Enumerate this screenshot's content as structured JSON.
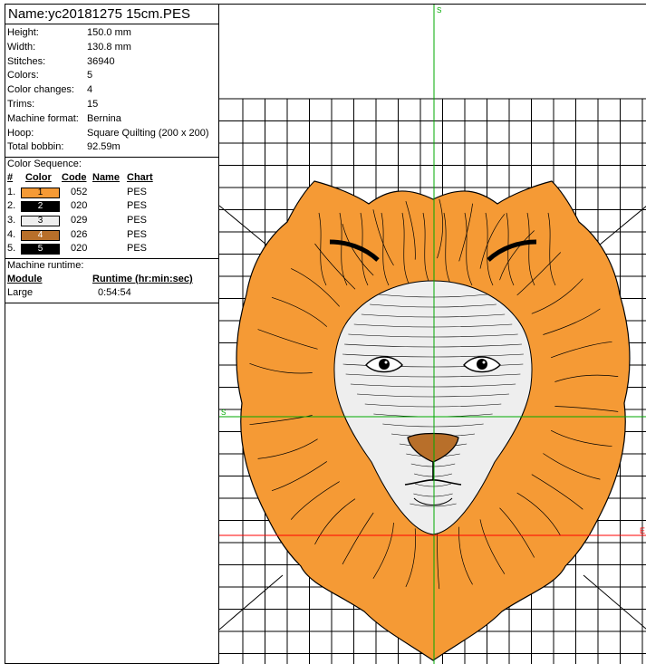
{
  "design": {
    "title": "Name:yc20181275 15cm.PES"
  },
  "properties": [
    {
      "label": "Height:",
      "value": "150.0 mm"
    },
    {
      "label": "Width:",
      "value": "130.8 mm"
    },
    {
      "label": "Stitches:",
      "value": "36940"
    },
    {
      "label": "Colors:",
      "value": "5"
    },
    {
      "label": "Color changes:",
      "value": "4"
    },
    {
      "label": "Trims:",
      "value": "15"
    },
    {
      "label": "Machine format:",
      "value": "Bernina"
    },
    {
      "label": "Hoop:",
      "value": "Square Quilting (200 x 200)"
    },
    {
      "label": "Total bobbin:",
      "value": "92.59m"
    }
  ],
  "color_sequence": {
    "title": "Color Sequence:",
    "headers": {
      "num": "#",
      "color": "Color",
      "code": "Code",
      "name": "Name",
      "chart": "Chart"
    },
    "rows": [
      {
        "num": "1.",
        "swatch_label": "1",
        "swatch_color": "#f59a35",
        "text_color": "#000000",
        "code": "052",
        "name": "",
        "chart": "PES"
      },
      {
        "num": "2.",
        "swatch_label": "2",
        "swatch_color": "#000000",
        "text_color": "#ffffff",
        "code": "020",
        "name": "",
        "chart": "PES"
      },
      {
        "num": "3.",
        "swatch_label": "3",
        "swatch_color": "#eeeeee",
        "text_color": "#000000",
        "code": "029",
        "name": "",
        "chart": "PES"
      },
      {
        "num": "4.",
        "swatch_label": "4",
        "swatch_color": "#b86f2a",
        "text_color": "#ffffff",
        "code": "026",
        "name": "",
        "chart": "PES"
      },
      {
        "num": "5.",
        "swatch_label": "5",
        "swatch_color": "#000000",
        "text_color": "#ffffff",
        "code": "020",
        "name": "",
        "chart": "PES"
      }
    ]
  },
  "runtime": {
    "title": "Machine runtime:",
    "headers": {
      "module": "Module",
      "runtime": "Runtime (hr:min:sec)"
    },
    "rows": [
      {
        "module": "Large",
        "runtime": "0:54:54"
      }
    ]
  },
  "canvas": {
    "axis_top_label": "S",
    "axis_left_label": "S",
    "axis_right_label": "E",
    "colors": {
      "mane": "#f59a35",
      "mane_dark": "#d9822a",
      "face": "#eeeeee",
      "nose": "#b86f2a",
      "grid": "#000000",
      "axis_green": "#00aa00",
      "axis_red": "#ff0000"
    }
  }
}
